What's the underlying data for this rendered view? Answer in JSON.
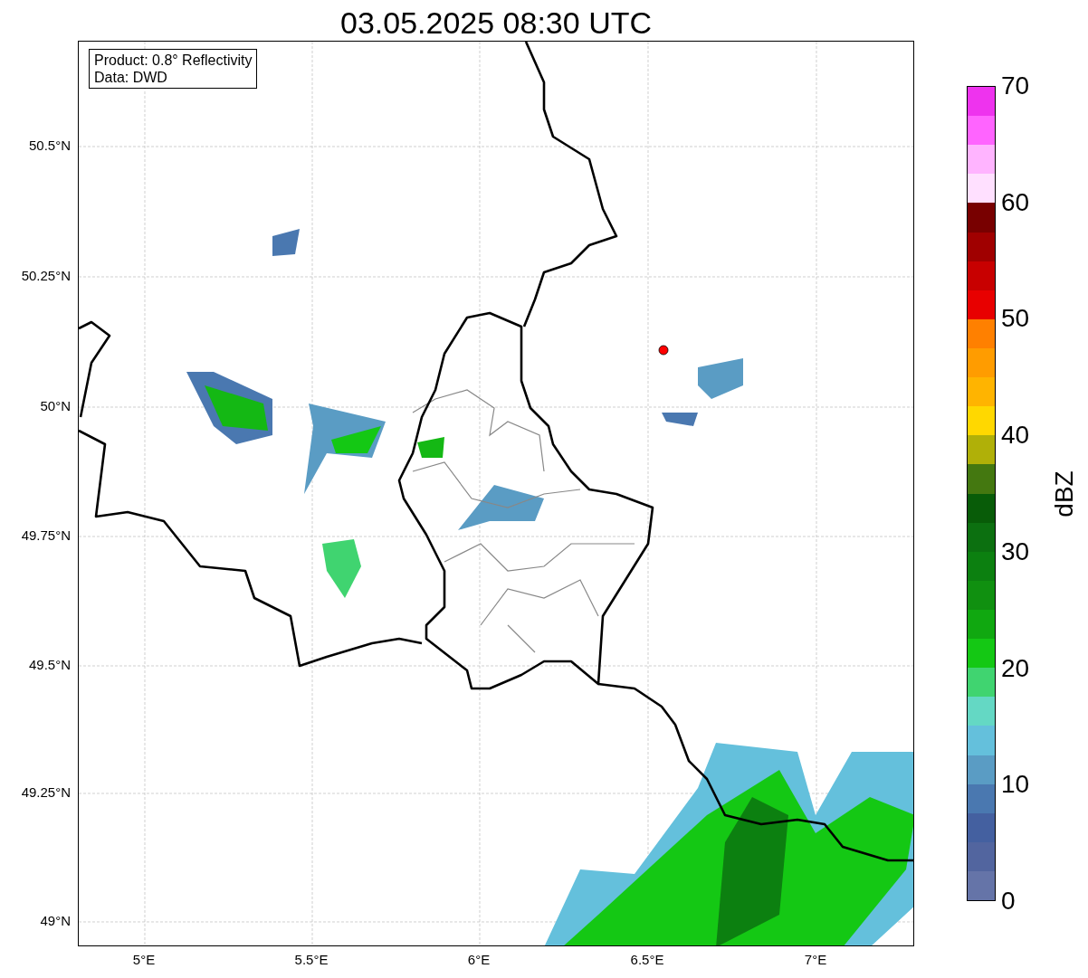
{
  "title": "03.05.2025 08:30 UTC",
  "info_box": {
    "lines": [
      "Product: 0.8° Reflectivity",
      "Data: DWD"
    ]
  },
  "y_ticks": [
    "50.5°N",
    "50.25°N",
    "50°N",
    "49.75°N",
    "49.5°N",
    "49.25°N",
    "49°N"
  ],
  "x_ticks": [
    "5°E",
    "5.5°E",
    "6°E",
    "6.5°E",
    "7°E"
  ],
  "colorbar": {
    "label": "dBZ",
    "ticks": [
      "70",
      "60",
      "50",
      "40",
      "30",
      "20",
      "10",
      "0"
    ],
    "bands": [
      {
        "color": "#ee33ee"
      },
      {
        "color": "#ff64ff"
      },
      {
        "color": "#ffb4ff"
      },
      {
        "color": "#ffe0ff"
      },
      {
        "color": "#780000"
      },
      {
        "color": "#a00000"
      },
      {
        "color": "#c80000"
      },
      {
        "color": "#e80000"
      },
      {
        "color": "#ff8000"
      },
      {
        "color": "#ff9c00"
      },
      {
        "color": "#ffb400"
      },
      {
        "color": "#ffd800"
      },
      {
        "color": "#b0b008"
      },
      {
        "color": "#447810"
      },
      {
        "color": "#085c08"
      },
      {
        "color": "#0c7010"
      },
      {
        "color": "#0c8010"
      },
      {
        "color": "#109010"
      },
      {
        "color": "#10a810"
      },
      {
        "color": "#14c814"
      },
      {
        "color": "#40d470"
      },
      {
        "color": "#64d8c4"
      },
      {
        "color": "#64c0dc"
      },
      {
        "color": "#5a9cc4"
      },
      {
        "color": "#4a78b0"
      },
      {
        "color": "#4460a0"
      },
      {
        "color": "#52659f"
      },
      {
        "color": "#6574a8"
      }
    ]
  }
}
